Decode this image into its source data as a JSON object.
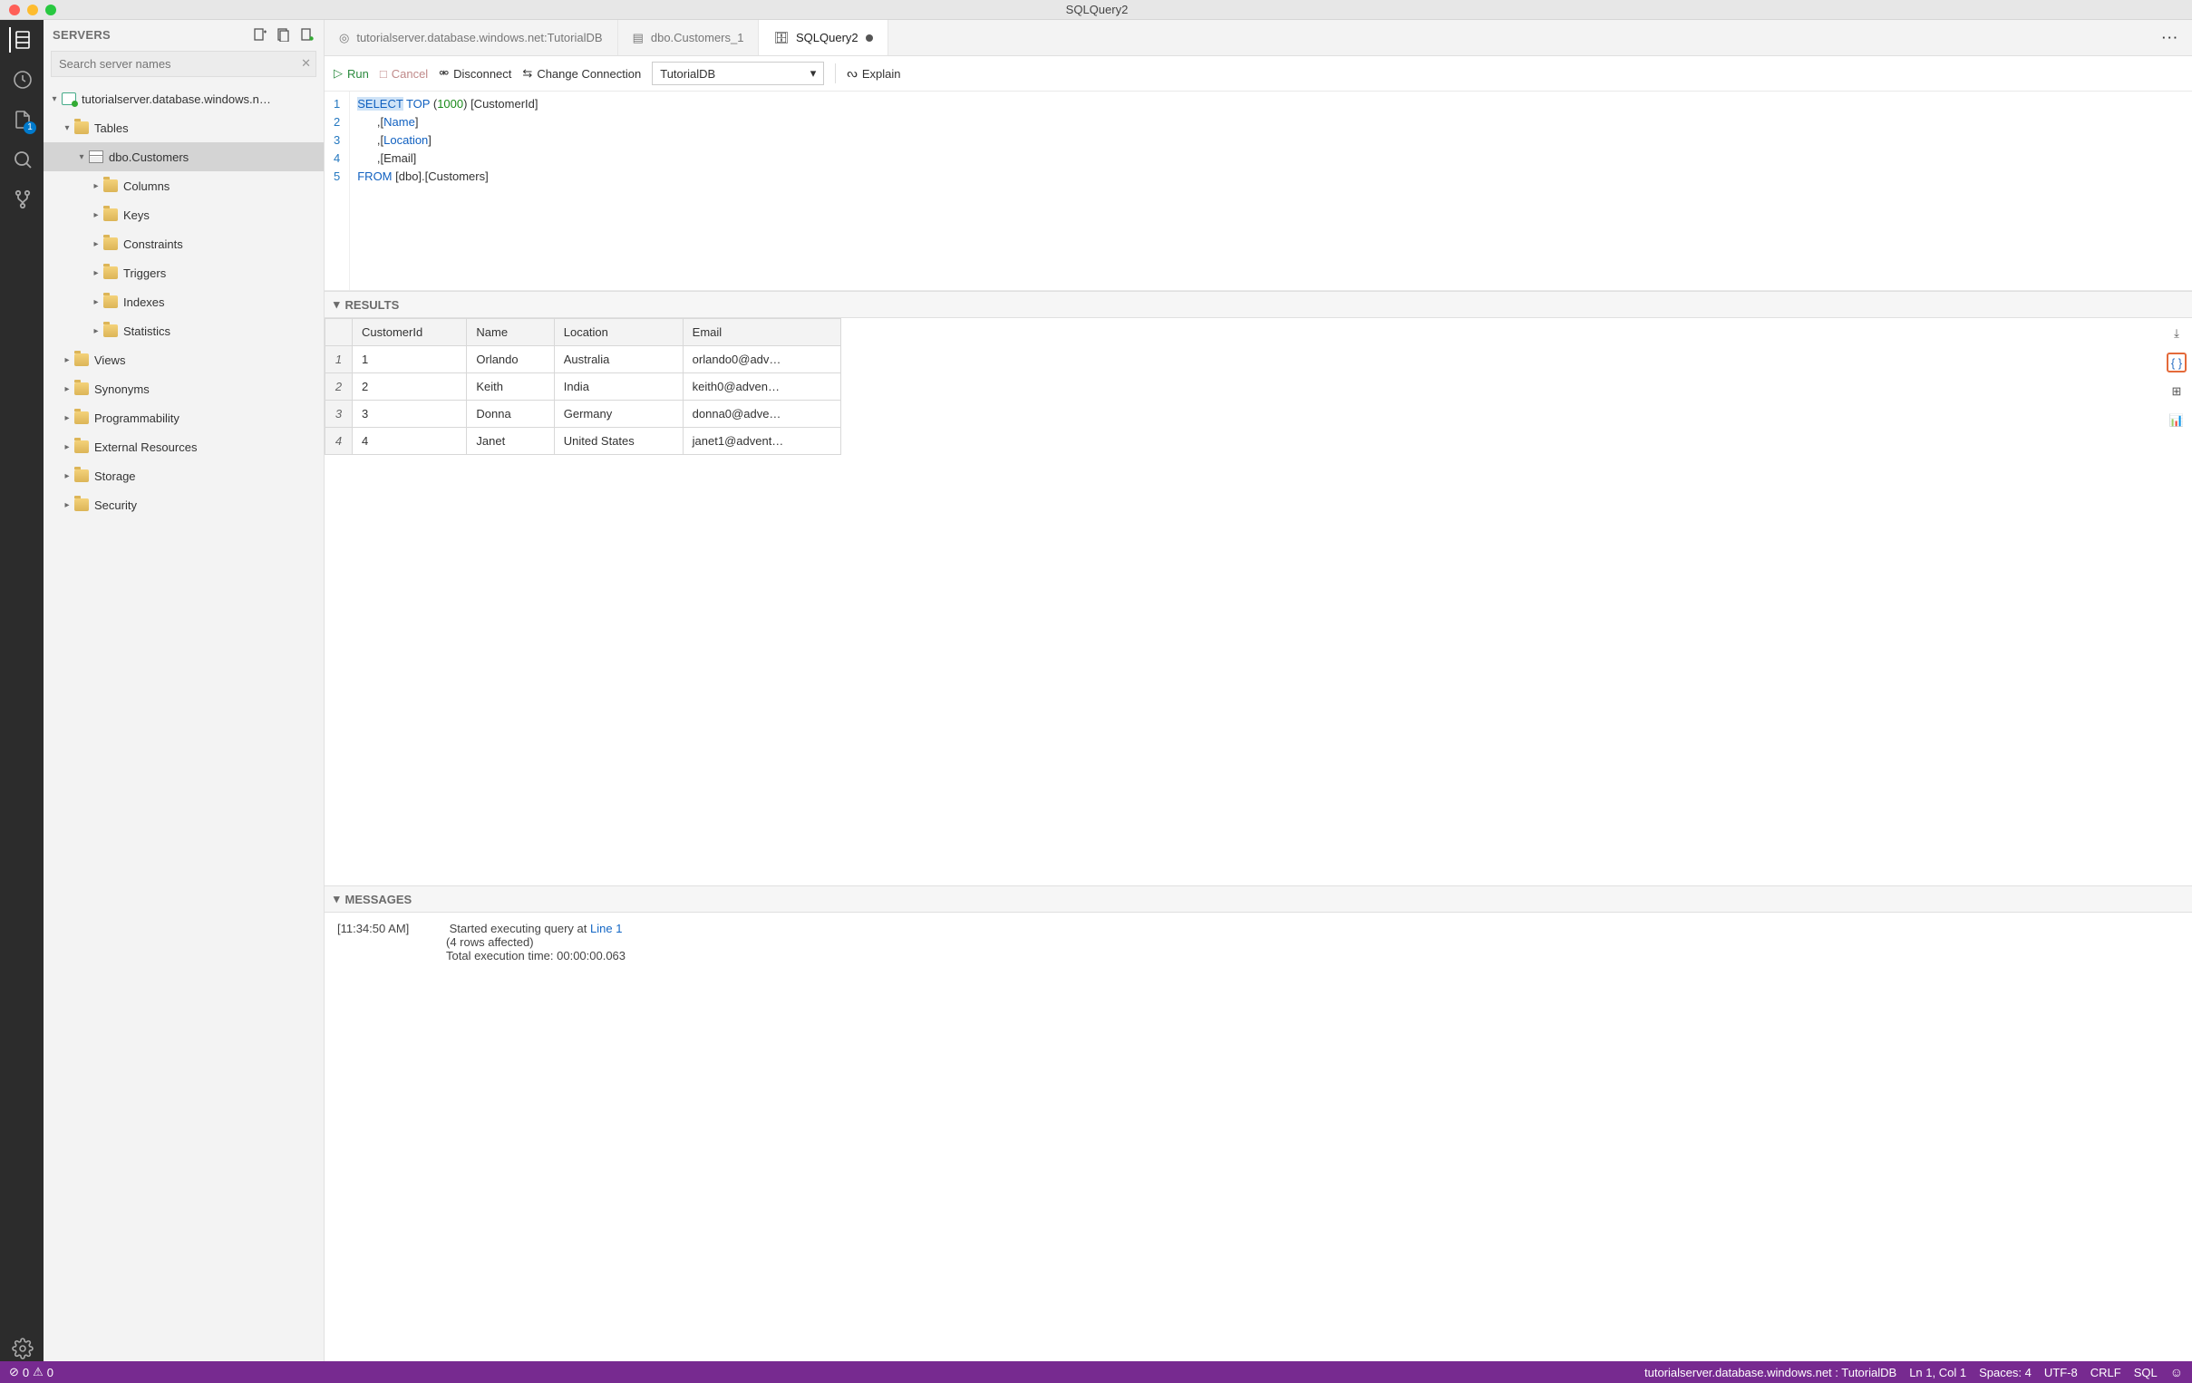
{
  "window": {
    "title": "SQLQuery2"
  },
  "sidebar": {
    "header": "SERVERS",
    "search_placeholder": "Search server names",
    "server": "tutorialserver.database.windows.n…",
    "nodes": {
      "tables": "Tables",
      "customers": "dbo.Customers",
      "columns": "Columns",
      "keys": "Keys",
      "constraints": "Constraints",
      "triggers": "Triggers",
      "indexes": "Indexes",
      "statistics": "Statistics",
      "views": "Views",
      "synonyms": "Synonyms",
      "programmability": "Programmability",
      "external_resources": "External Resources",
      "storage": "Storage",
      "security": "Security"
    }
  },
  "tabs": {
    "t1": "tutorialserver.database.windows.net:TutorialDB",
    "t2": "dbo.Customers_1",
    "t3": "SQLQuery2"
  },
  "toolbar": {
    "run": "Run",
    "cancel": "Cancel",
    "disconnect": "Disconnect",
    "change_conn": "Change Connection",
    "db": "TutorialDB",
    "explain": "Explain"
  },
  "editor": {
    "lines": [
      "1",
      "2",
      "3",
      "4",
      "5"
    ],
    "l1_kw1": "SELECT",
    "l1_kw2": "TOP",
    "l1_num": "1000",
    "l1_tail": " [CustomerId]",
    "l2_pfx": "      ,[",
    "l2_fld": "Name",
    "l2_sfx": "]",
    "l3_pfx": "      ,[",
    "l3_fld": "Location",
    "l3_sfx": "]",
    "l4": "      ,[Email]",
    "l5_kw": "FROM",
    "l5_tail": " [dbo].[Customers]"
  },
  "results": {
    "title": "RESULTS",
    "headers": {
      "c1": "CustomerId",
      "c2": "Name",
      "c3": "Location",
      "c4": "Email"
    },
    "rows": [
      {
        "n": "1",
        "id": "1",
        "name": "Orlando",
        "loc": "Australia",
        "email": "orlando0@adv…"
      },
      {
        "n": "2",
        "id": "2",
        "name": "Keith",
        "loc": "India",
        "email": "keith0@adven…"
      },
      {
        "n": "3",
        "id": "3",
        "name": "Donna",
        "loc": "Germany",
        "email": "donna0@adve…"
      },
      {
        "n": "4",
        "id": "4",
        "name": "Janet",
        "loc": "United States",
        "email": "janet1@advent…"
      }
    ]
  },
  "messages": {
    "title": "MESSAGES",
    "timestamp": "[11:34:50 AM]",
    "line1a": "Started executing query at ",
    "line1_link": "Line 1",
    "line2": "(4 rows affected)",
    "line3": "Total execution time: 00:00:00.063"
  },
  "status": {
    "errors": "0",
    "warnings": "0",
    "conn": "tutorialserver.database.windows.net : TutorialDB",
    "pos": "Ln 1, Col 1",
    "spaces": "Spaces: 4",
    "enc": "UTF-8",
    "eol": "CRLF",
    "lang": "SQL"
  },
  "activity_badge": "1"
}
